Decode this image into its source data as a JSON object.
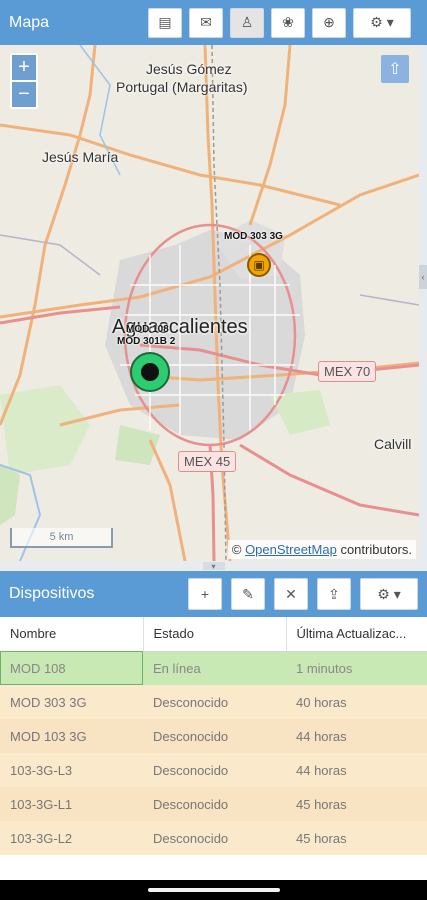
{
  "header": {
    "title": "Mapa",
    "buttons": [
      {
        "name": "report-icon",
        "glyph": "▤"
      },
      {
        "name": "chat-icon",
        "glyph": "✉"
      },
      {
        "name": "person-icon",
        "glyph": "♙"
      },
      {
        "name": "paw-icon",
        "glyph": "❀"
      },
      {
        "name": "crosshair-icon",
        "glyph": "⊕"
      }
    ],
    "settings_glyph": "⚙ ▾"
  },
  "map": {
    "zoom_in": "+",
    "zoom_out": "−",
    "upload_glyph": "⇧",
    "labels": {
      "jesus_gomez_1": "Jesús Gómez",
      "jesus_gomez_2": "Portugal (Margaritas)",
      "jesus_maria": "Jesús María",
      "city": "Aguascalientes",
      "calvillo": "Calvill",
      "mex70": "MEX 70",
      "mex45": "MEX 45"
    },
    "markers": {
      "mod303": "MOD 303 3G",
      "mod108": "MOD 108",
      "mod301": "MOD 301B 2"
    },
    "scale": "5 km",
    "attribution_link": "OpenStreetMap",
    "attribution_rest": " contributors.",
    "attribution_prefix": "© "
  },
  "devices": {
    "title": "Dispositivos",
    "columns": [
      "Nombre",
      "Estado",
      "Última Actualizac..."
    ],
    "rows": [
      {
        "name": "MOD 108",
        "status": "En línea",
        "updated": "1 minutos"
      },
      {
        "name": "MOD 303 3G",
        "status": "Desconocido",
        "updated": "40 horas"
      },
      {
        "name": "MOD 103 3G",
        "status": "Desconocido",
        "updated": "44 horas"
      },
      {
        "name": "103-3G-L3",
        "status": "Desconocido",
        "updated": "44 horas"
      },
      {
        "name": "103-3G-L1",
        "status": "Desconocido",
        "updated": "45 horas"
      },
      {
        "name": "103-3G-L2",
        "status": "Desconocido",
        "updated": "45 horas"
      }
    ]
  },
  "colors": {
    "header": "#5b9bd5",
    "online_row": "#c8e8b4",
    "unknown_row": "#fbe9cc",
    "marker_green": "#2ecc71",
    "marker_orange": "#f0a500"
  }
}
